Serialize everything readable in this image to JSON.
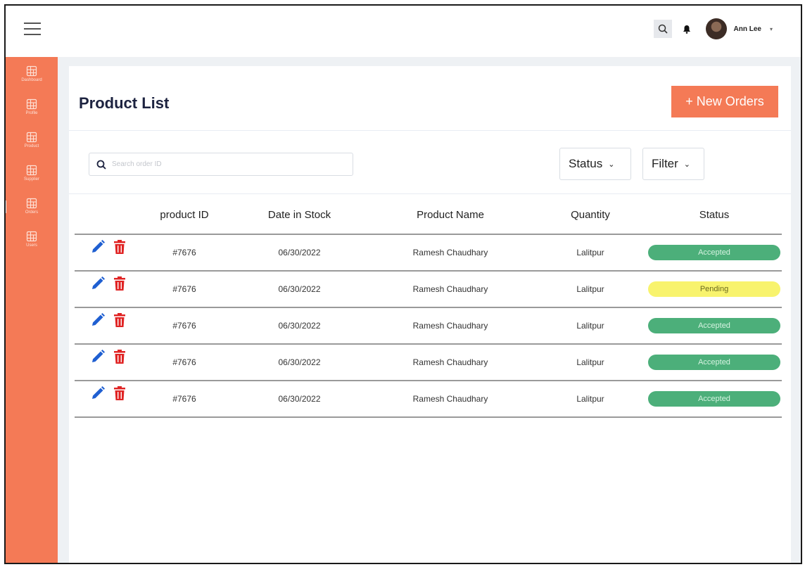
{
  "topbar": {
    "user_name": "Ann Lee",
    "icons": [
      "menu-icon",
      "search-icon",
      "bell-icon",
      "avatar"
    ]
  },
  "sidebar": {
    "items": [
      {
        "label": "Dashboard"
      },
      {
        "label": "Profile"
      },
      {
        "label": "Product"
      },
      {
        "label": "Supplier"
      },
      {
        "label": "Orders"
      },
      {
        "label": "Users"
      }
    ],
    "active": "Orders"
  },
  "main": {
    "title": "Product List",
    "new_order_label": "+ New Orders",
    "search_placeholder": "Search order ID",
    "status_dropdown": "Status",
    "filter_dropdown": "Filter"
  },
  "table": {
    "headers": [
      "product ID",
      "Date in Stock",
      "Product Name",
      "Quantity",
      "Status"
    ],
    "rows": [
      {
        "id": "#7676",
        "date": "06/30/2022",
        "name": "Ramesh Chaudhary",
        "qty": "Lalitpur",
        "status": "Accepted"
      },
      {
        "id": "#7676",
        "date": "06/30/2022",
        "name": "Ramesh Chaudhary",
        "qty": "Lalitpur",
        "status": "Pending"
      },
      {
        "id": "#7676",
        "date": "06/30/2022",
        "name": "Ramesh Chaudhary",
        "qty": "Lalitpur",
        "status": "Accepted"
      },
      {
        "id": "#7676",
        "date": "06/30/2022",
        "name": "Ramesh Chaudhary",
        "qty": "Lalitpur",
        "status": "Accepted"
      },
      {
        "id": "#7676",
        "date": "06/30/2022",
        "name": "Ramesh Chaudhary",
        "qty": "Lalitpur",
        "status": "Accepted"
      }
    ]
  },
  "colors": {
    "accent": "#f47a56",
    "accepted": "#4caf7a",
    "pending": "#f8f36d",
    "edit_icon": "#1f5fd1",
    "delete_icon": "#e02424"
  }
}
